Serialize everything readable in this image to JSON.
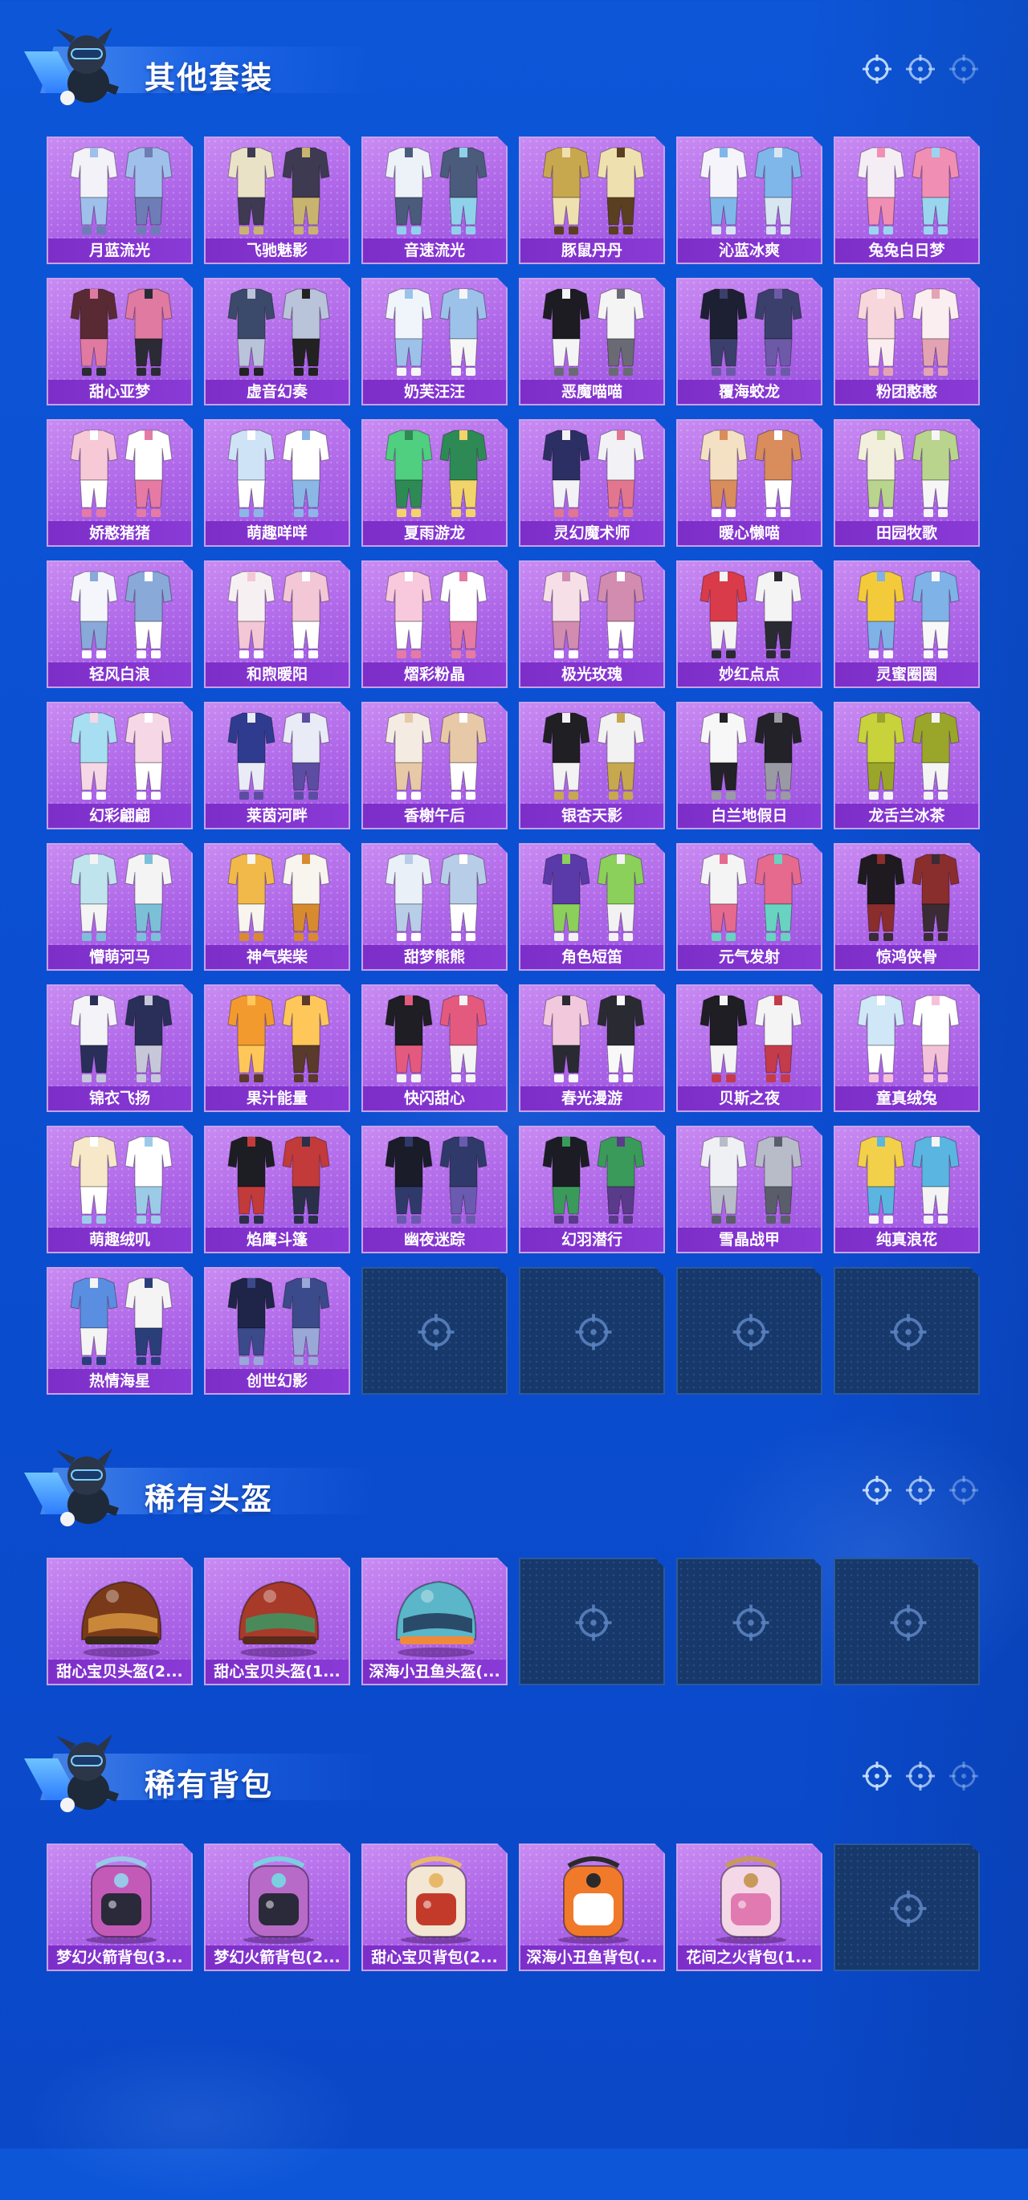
{
  "sections": [
    {
      "title": "其他套装",
      "items": [
        {
          "label": "月蓝流光",
          "kind": "outfit",
          "palette": [
            "#f2f2f8",
            "#9fc0ea",
            "#6e7db5"
          ]
        },
        {
          "label": "飞驰魅影",
          "kind": "outfit",
          "palette": [
            "#e9e2c6",
            "#3d3a52",
            "#c8b46e"
          ]
        },
        {
          "label": "音速流光",
          "kind": "outfit",
          "palette": [
            "#ecf2f8",
            "#4a5b7c",
            "#8fd1ea"
          ]
        },
        {
          "label": "豚鼠丹丹",
          "kind": "outfit",
          "palette": [
            "#c8a84f",
            "#efe0b0",
            "#5a3f20"
          ]
        },
        {
          "label": "沁蓝冰爽",
          "kind": "outfit",
          "palette": [
            "#f4f4fa",
            "#7fb7ea",
            "#d8e6f2"
          ]
        },
        {
          "label": "兔兔白日梦",
          "kind": "outfit",
          "palette": [
            "#f4eef4",
            "#f08fb3",
            "#9ad5ef"
          ]
        },
        {
          "label": "甜心亚梦",
          "kind": "outfit",
          "palette": [
            "#5a2a34",
            "#e07aa0",
            "#2b2b35"
          ]
        },
        {
          "label": "虚音幻奏",
          "kind": "outfit",
          "palette": [
            "#3b4a6a",
            "#b9c4da",
            "#222"
          ]
        },
        {
          "label": "奶芙汪汪",
          "kind": "outfit",
          "palette": [
            "#f0f4fb",
            "#9cc2ea",
            "#f6f6f6"
          ]
        },
        {
          "label": "恶魔喵喵",
          "kind": "outfit",
          "palette": [
            "#1c1c22",
            "#f4f4f4",
            "#6a6a74"
          ]
        },
        {
          "label": "覆海蛟龙",
          "kind": "outfit",
          "palette": [
            "#1d2033",
            "#3b3f6b",
            "#6c5aa8"
          ]
        },
        {
          "label": "粉团憨憨",
          "kind": "outfit",
          "palette": [
            "#f7d6dc",
            "#fbeef0",
            "#e3a3b3"
          ]
        },
        {
          "label": "娇憨猪猪",
          "kind": "outfit",
          "palette": [
            "#f7c9d7",
            "#ffffff",
            "#e57aa4"
          ]
        },
        {
          "label": "萌趣咩咩",
          "kind": "outfit",
          "palette": [
            "#cfe3f6",
            "#ffffff",
            "#8bb7e6"
          ]
        },
        {
          "label": "夏雨游龙",
          "kind": "outfit",
          "palette": [
            "#4fcf7f",
            "#2e8a55",
            "#f2d46a"
          ]
        },
        {
          "label": "灵幻魔术师",
          "kind": "outfit",
          "palette": [
            "#2c2f63",
            "#f2f2f6",
            "#e3768f"
          ]
        },
        {
          "label": "暖心懒喵",
          "kind": "outfit",
          "palette": [
            "#f4e1c4",
            "#d98c5c",
            "#ffffff"
          ]
        },
        {
          "label": "田园牧歌",
          "kind": "outfit",
          "palette": [
            "#f2efdc",
            "#b9d48d",
            "#f6f6f6"
          ]
        },
        {
          "label": "轻风白浪",
          "kind": "outfit",
          "palette": [
            "#f4f6fb",
            "#89a9d8",
            "#ffffff"
          ]
        },
        {
          "label": "和煦暖阳",
          "kind": "outfit",
          "palette": [
            "#f7f0f3",
            "#f3c7d6",
            "#ffffff"
          ]
        },
        {
          "label": "熠彩粉晶",
          "kind": "outfit",
          "palette": [
            "#f8c8dc",
            "#ffffff",
            "#e57aa4"
          ]
        },
        {
          "label": "极光玫瑰",
          "kind": "outfit",
          "palette": [
            "#f7dfe7",
            "#d18cb0",
            "#ffffff"
          ]
        },
        {
          "label": "妙红点点",
          "kind": "outfit",
          "palette": [
            "#d93b4a",
            "#f4f4f4",
            "#2a2a33"
          ]
        },
        {
          "label": "灵蜜圈圈",
          "kind": "outfit",
          "palette": [
            "#f3cb3a",
            "#7fb2e6",
            "#f8f8f8"
          ]
        },
        {
          "label": "幻彩翩翩",
          "kind": "outfit",
          "palette": [
            "#a7def2",
            "#f6d7e6",
            "#ffffff"
          ]
        },
        {
          "label": "莱茵河畔",
          "kind": "outfit",
          "palette": [
            "#2f3b8f",
            "#e9ecf6",
            "#5c4da3"
          ]
        },
        {
          "label": "香榭午后",
          "kind": "outfit",
          "palette": [
            "#f4ece2",
            "#e7c9a8",
            "#ffffff"
          ]
        },
        {
          "label": "银杏天影",
          "kind": "outfit",
          "palette": [
            "#1f1f24",
            "#f2f2f2",
            "#c7a84f"
          ]
        },
        {
          "label": "白兰地假日",
          "kind": "outfit",
          "palette": [
            "#f7f7f7",
            "#222228",
            "#9a9aa4"
          ]
        },
        {
          "label": "龙舌兰冰茶",
          "kind": "outfit",
          "palette": [
            "#c8d23a",
            "#9aa62a",
            "#f4f4f4"
          ]
        },
        {
          "label": "懵萌河马",
          "kind": "outfit",
          "palette": [
            "#bfe4ee",
            "#f4f4f4",
            "#7cc0d8"
          ]
        },
        {
          "label": "神气柴柴",
          "kind": "outfit",
          "palette": [
            "#f1b94a",
            "#f8f4ee",
            "#d88a2f"
          ]
        },
        {
          "label": "甜梦熊熊",
          "kind": "outfit",
          "palette": [
            "#e9f0f8",
            "#b8cde8",
            "#ffffff"
          ]
        },
        {
          "label": "角色短笛",
          "kind": "outfit",
          "palette": [
            "#5a3aa8",
            "#8bd05a",
            "#f2f2f2"
          ]
        },
        {
          "label": "元气发射",
          "kind": "outfit",
          "palette": [
            "#f4f4f4",
            "#e56a8e",
            "#67d3c0"
          ]
        },
        {
          "label": "惊鸿侠骨",
          "kind": "outfit",
          "palette": [
            "#1e1a20",
            "#8a2d2d",
            "#3b2b34"
          ]
        },
        {
          "label": "锦衣飞扬",
          "kind": "outfit",
          "palette": [
            "#f4f4f8",
            "#2a2f5a",
            "#c6c8da"
          ]
        },
        {
          "label": "果汁能量",
          "kind": "outfit",
          "palette": [
            "#f39a2e",
            "#ffc75a",
            "#5a3a2a"
          ]
        },
        {
          "label": "快闪甜心",
          "kind": "outfit",
          "palette": [
            "#1e1e24",
            "#e45a7e",
            "#f4f4f4"
          ]
        },
        {
          "label": "春光漫游",
          "kind": "outfit",
          "palette": [
            "#f2c9dc",
            "#2a2a33",
            "#f8f8f8"
          ]
        },
        {
          "label": "贝斯之夜",
          "kind": "outfit",
          "palette": [
            "#1e1e24",
            "#f4f4f4",
            "#c43b4a"
          ]
        },
        {
          "label": "童真绒兔",
          "kind": "outfit",
          "palette": [
            "#cfe7f6",
            "#ffffff",
            "#f4c2d8"
          ]
        },
        {
          "label": "萌趣绒叽",
          "kind": "outfit",
          "palette": [
            "#f6e8c9",
            "#ffffff",
            "#9ccbe8"
          ]
        },
        {
          "label": "焰鹰斗篷",
          "kind": "outfit",
          "palette": [
            "#1d1d24",
            "#c23a3a",
            "#2a2f4a"
          ]
        },
        {
          "label": "幽夜迷踪",
          "kind": "outfit",
          "palette": [
            "#1a1c2a",
            "#2f3a6a",
            "#6a5ab0"
          ]
        },
        {
          "label": "幻羽潜行",
          "kind": "outfit",
          "palette": [
            "#1c1d24",
            "#3a9a5a",
            "#5a3a8a"
          ]
        },
        {
          "label": "雪晶战甲",
          "kind": "outfit",
          "palette": [
            "#eef0f4",
            "#b8bcc8",
            "#5a5e6a"
          ]
        },
        {
          "label": "纯真浪花",
          "kind": "outfit",
          "palette": [
            "#f2d04a",
            "#5ab6e0",
            "#f4f4f4"
          ]
        },
        {
          "label": "热情海星",
          "kind": "outfit",
          "palette": [
            "#5a8ee0",
            "#f4f4f4",
            "#2a3f7a"
          ]
        },
        {
          "label": "创世幻影",
          "kind": "outfit",
          "palette": [
            "#1e2548",
            "#3a4a8a",
            "#9aa8d8"
          ]
        }
      ],
      "total_slots": 54
    },
    {
      "title": "稀有头盔",
      "items": [
        {
          "label": "甜心宝贝头盔(2...",
          "kind": "helmet",
          "palette": [
            "#7a3a1a",
            "#c9873a",
            "#3a2a1a"
          ]
        },
        {
          "label": "甜心宝贝头盔(1...",
          "kind": "helmet",
          "palette": [
            "#a83a2a",
            "#4a8a5a",
            "#5a2a1a"
          ]
        },
        {
          "label": "深海小丑鱼头盔(...",
          "kind": "helmet",
          "palette": [
            "#5ab6c8",
            "#2a4a6a",
            "#f08a3a"
          ]
        }
      ],
      "total_slots": 6
    },
    {
      "title": "稀有背包",
      "items": [
        {
          "label": "梦幻火箭背包(3...",
          "kind": "backpack",
          "palette": [
            "#c45ab8",
            "#2a2a3a",
            "#9ac8e8"
          ]
        },
        {
          "label": "梦幻火箭背包(2...",
          "kind": "backpack",
          "palette": [
            "#b86ac8",
            "#2a2a3a",
            "#7ad0e0"
          ]
        },
        {
          "label": "甜心宝贝背包(2...",
          "kind": "backpack",
          "palette": [
            "#f4e6d4",
            "#c43a2a",
            "#e8b86a"
          ]
        },
        {
          "label": "深海小丑鱼背包(...",
          "kind": "backpack",
          "palette": [
            "#f07a2a",
            "#ffffff",
            "#2a2a2a"
          ]
        },
        {
          "label": "花间之火背包(1...",
          "kind": "backpack",
          "palette": [
            "#f4d8e8",
            "#e07ab0",
            "#c89a5a"
          ]
        }
      ],
      "total_slots": 6
    }
  ],
  "colors": {
    "card_bg": "#b06ae8",
    "card_label_bg": "#7d2ec8",
    "empty_bg": "#17386a",
    "page_bg": "#0b4fd2"
  },
  "icons": {
    "header_targets": [
      "crosshair-icon",
      "crosshair-icon",
      "crosshair-icon"
    ],
    "mascot": "mascot-icon",
    "empty_slot": "crosshair-icon"
  }
}
